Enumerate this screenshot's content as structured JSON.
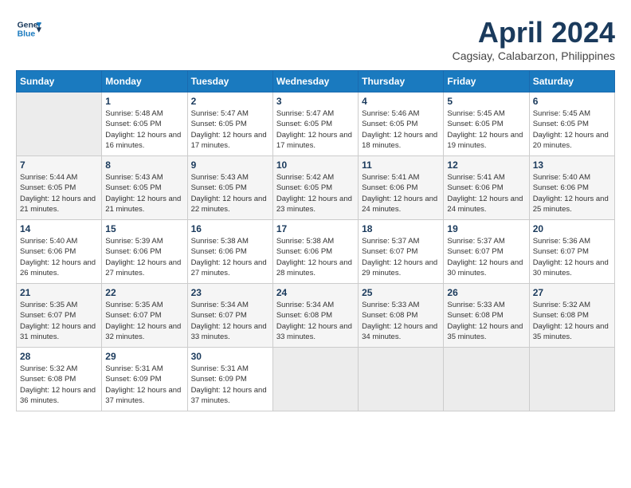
{
  "header": {
    "logo_line1": "General",
    "logo_line2": "Blue",
    "month": "April 2024",
    "location": "Cagsiay, Calabarzon, Philippines"
  },
  "weekdays": [
    "Sunday",
    "Monday",
    "Tuesday",
    "Wednesday",
    "Thursday",
    "Friday",
    "Saturday"
  ],
  "weeks": [
    [
      {
        "day": "",
        "empty": true
      },
      {
        "day": "1",
        "sunrise": "5:48 AM",
        "sunset": "6:05 PM",
        "daylight": "12 hours and 16 minutes."
      },
      {
        "day": "2",
        "sunrise": "5:47 AM",
        "sunset": "6:05 PM",
        "daylight": "12 hours and 17 minutes."
      },
      {
        "day": "3",
        "sunrise": "5:47 AM",
        "sunset": "6:05 PM",
        "daylight": "12 hours and 17 minutes."
      },
      {
        "day": "4",
        "sunrise": "5:46 AM",
        "sunset": "6:05 PM",
        "daylight": "12 hours and 18 minutes."
      },
      {
        "day": "5",
        "sunrise": "5:45 AM",
        "sunset": "6:05 PM",
        "daylight": "12 hours and 19 minutes."
      },
      {
        "day": "6",
        "sunrise": "5:45 AM",
        "sunset": "6:05 PM",
        "daylight": "12 hours and 20 minutes."
      }
    ],
    [
      {
        "day": "7",
        "sunrise": "5:44 AM",
        "sunset": "6:05 PM",
        "daylight": "12 hours and 21 minutes."
      },
      {
        "day": "8",
        "sunrise": "5:43 AM",
        "sunset": "6:05 PM",
        "daylight": "12 hours and 21 minutes."
      },
      {
        "day": "9",
        "sunrise": "5:43 AM",
        "sunset": "6:05 PM",
        "daylight": "12 hours and 22 minutes."
      },
      {
        "day": "10",
        "sunrise": "5:42 AM",
        "sunset": "6:05 PM",
        "daylight": "12 hours and 23 minutes."
      },
      {
        "day": "11",
        "sunrise": "5:41 AM",
        "sunset": "6:06 PM",
        "daylight": "12 hours and 24 minutes."
      },
      {
        "day": "12",
        "sunrise": "5:41 AM",
        "sunset": "6:06 PM",
        "daylight": "12 hours and 24 minutes."
      },
      {
        "day": "13",
        "sunrise": "5:40 AM",
        "sunset": "6:06 PM",
        "daylight": "12 hours and 25 minutes."
      }
    ],
    [
      {
        "day": "14",
        "sunrise": "5:40 AM",
        "sunset": "6:06 PM",
        "daylight": "12 hours and 26 minutes."
      },
      {
        "day": "15",
        "sunrise": "5:39 AM",
        "sunset": "6:06 PM",
        "daylight": "12 hours and 27 minutes."
      },
      {
        "day": "16",
        "sunrise": "5:38 AM",
        "sunset": "6:06 PM",
        "daylight": "12 hours and 27 minutes."
      },
      {
        "day": "17",
        "sunrise": "5:38 AM",
        "sunset": "6:06 PM",
        "daylight": "12 hours and 28 minutes."
      },
      {
        "day": "18",
        "sunrise": "5:37 AM",
        "sunset": "6:07 PM",
        "daylight": "12 hours and 29 minutes."
      },
      {
        "day": "19",
        "sunrise": "5:37 AM",
        "sunset": "6:07 PM",
        "daylight": "12 hours and 30 minutes."
      },
      {
        "day": "20",
        "sunrise": "5:36 AM",
        "sunset": "6:07 PM",
        "daylight": "12 hours and 30 minutes."
      }
    ],
    [
      {
        "day": "21",
        "sunrise": "5:35 AM",
        "sunset": "6:07 PM",
        "daylight": "12 hours and 31 minutes."
      },
      {
        "day": "22",
        "sunrise": "5:35 AM",
        "sunset": "6:07 PM",
        "daylight": "12 hours and 32 minutes."
      },
      {
        "day": "23",
        "sunrise": "5:34 AM",
        "sunset": "6:07 PM",
        "daylight": "12 hours and 33 minutes."
      },
      {
        "day": "24",
        "sunrise": "5:34 AM",
        "sunset": "6:08 PM",
        "daylight": "12 hours and 33 minutes."
      },
      {
        "day": "25",
        "sunrise": "5:33 AM",
        "sunset": "6:08 PM",
        "daylight": "12 hours and 34 minutes."
      },
      {
        "day": "26",
        "sunrise": "5:33 AM",
        "sunset": "6:08 PM",
        "daylight": "12 hours and 35 minutes."
      },
      {
        "day": "27",
        "sunrise": "5:32 AM",
        "sunset": "6:08 PM",
        "daylight": "12 hours and 35 minutes."
      }
    ],
    [
      {
        "day": "28",
        "sunrise": "5:32 AM",
        "sunset": "6:08 PM",
        "daylight": "12 hours and 36 minutes."
      },
      {
        "day": "29",
        "sunrise": "5:31 AM",
        "sunset": "6:09 PM",
        "daylight": "12 hours and 37 minutes."
      },
      {
        "day": "30",
        "sunrise": "5:31 AM",
        "sunset": "6:09 PM",
        "daylight": "12 hours and 37 minutes."
      },
      {
        "day": "",
        "empty": true
      },
      {
        "day": "",
        "empty": true
      },
      {
        "day": "",
        "empty": true
      },
      {
        "day": "",
        "empty": true
      }
    ]
  ]
}
